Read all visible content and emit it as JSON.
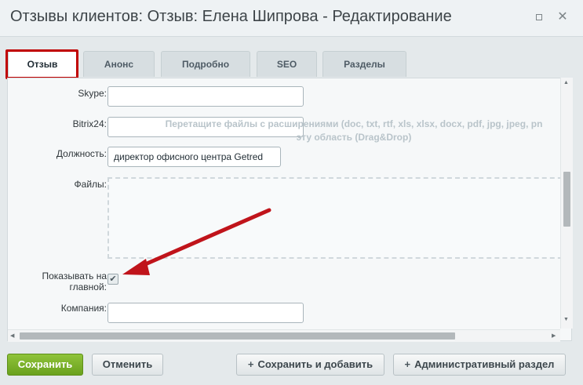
{
  "window": {
    "title": "Отзывы клиентов: Отзыв: Елена Шипрова - Редактирование"
  },
  "tabs": [
    {
      "label": "Отзыв",
      "active": true
    },
    {
      "label": "Анонс",
      "active": false
    },
    {
      "label": "Подробно",
      "active": false
    },
    {
      "label": "SEO",
      "active": false
    },
    {
      "label": "Разделы",
      "active": false
    }
  ],
  "form": {
    "skype": {
      "label": "Skype:",
      "value": ""
    },
    "bitrix24": {
      "label": "Bitrix24:",
      "value": ""
    },
    "position": {
      "label": "Должность:",
      "value": "директор офисного центра Getred"
    },
    "files": {
      "label": "Файлы:",
      "dropzone_line1": "Перетащите файлы с расширениями (doc, txt, rtf, xls, xlsx, docx, pdf, jpg, jpeg, pn",
      "dropzone_line2": "эту область (Drag&Drop)"
    },
    "show_on_main": {
      "label_line1": "Показывать на",
      "label_line2": "главной:",
      "checked": true,
      "check_glyph": "✔"
    },
    "company": {
      "label": "Компания:",
      "value": ""
    }
  },
  "buttons": {
    "save": "Сохранить",
    "cancel": "Отменить",
    "save_add": "Сохранить и добавить",
    "admin": "Административный раздел",
    "plus_glyph": "+"
  },
  "colors": {
    "highlight_frame": "#c00000",
    "annotation_arrow": "#c0141b",
    "save_button": "#7cb02a"
  },
  "icons": [
    "maximize-icon",
    "close-icon",
    "checkmark-icon",
    "plus-icon",
    "annotation-arrow"
  ]
}
